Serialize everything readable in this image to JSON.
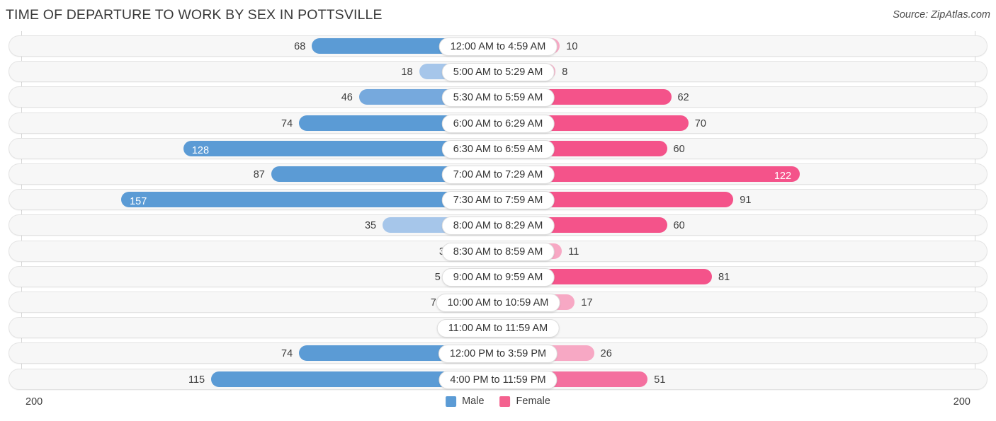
{
  "header": {
    "title": "TIME OF DEPARTURE TO WORK BY SEX IN POTTSVILLE",
    "source": "Source: ZipAtlas.com"
  },
  "axis": {
    "left_label": "200",
    "right_label": "200"
  },
  "legend": {
    "items": [
      {
        "label": "Male",
        "color": "#5b9bd5"
      },
      {
        "label": "Female",
        "color": "#f4628f"
      }
    ]
  },
  "colors": {
    "male_dark": "#5b9bd5",
    "male_mid": "#76a9dd",
    "male_light": "#a6c6ea",
    "female_dark": "#f4538a",
    "female_mid": "#f4709f",
    "female_light": "#f7a8c4",
    "track_fill": "#f7f7f7",
    "track_border": "#e3e3e3",
    "gridline": "#d7d7d7",
    "text": "#3c3c3c"
  },
  "chart_data": {
    "type": "bar",
    "title": "TIME OF DEPARTURE TO WORK BY SEX IN POTTSVILLE",
    "subtitle": "",
    "orientation": "horizontal-diverging",
    "xlabel": "",
    "ylabel": "",
    "axis_max": 200,
    "grid": true,
    "legend_position": "bottom-center",
    "categories": [
      "12:00 AM to 4:59 AM",
      "5:00 AM to 5:29 AM",
      "5:30 AM to 5:59 AM",
      "6:00 AM to 6:29 AM",
      "6:30 AM to 6:59 AM",
      "7:00 AM to 7:29 AM",
      "7:30 AM to 7:59 AM",
      "8:00 AM to 8:29 AM",
      "8:30 AM to 8:59 AM",
      "9:00 AM to 9:59 AM",
      "10:00 AM to 10:59 AM",
      "11:00 AM to 11:59 AM",
      "12:00 PM to 3:59 PM",
      "4:00 PM to 11:59 PM"
    ],
    "series": [
      {
        "name": "Male",
        "values": [
          68,
          18,
          46,
          74,
          128,
          87,
          157,
          35,
          3,
          5,
          7,
          0,
          74,
          115
        ]
      },
      {
        "name": "Female",
        "values": [
          10,
          8,
          62,
          70,
          60,
          122,
          91,
          60,
          11,
          81,
          17,
          0,
          26,
          51
        ]
      }
    ]
  },
  "rows": [
    {
      "label": "12:00 AM to 4:59 AM",
      "male": "68",
      "female": "10"
    },
    {
      "label": "5:00 AM to 5:29 AM",
      "male": "18",
      "female": "8"
    },
    {
      "label": "5:30 AM to 5:59 AM",
      "male": "46",
      "female": "62"
    },
    {
      "label": "6:00 AM to 6:29 AM",
      "male": "74",
      "female": "70"
    },
    {
      "label": "6:30 AM to 6:59 AM",
      "male": "128",
      "female": "60"
    },
    {
      "label": "7:00 AM to 7:29 AM",
      "male": "87",
      "female": "122"
    },
    {
      "label": "7:30 AM to 7:59 AM",
      "male": "157",
      "female": "91"
    },
    {
      "label": "8:00 AM to 8:29 AM",
      "male": "35",
      "female": "60"
    },
    {
      "label": "8:30 AM to 8:59 AM",
      "male": "3",
      "female": "11"
    },
    {
      "label": "9:00 AM to 9:59 AM",
      "male": "5",
      "female": "81"
    },
    {
      "label": "10:00 AM to 10:59 AM",
      "male": "7",
      "female": "17"
    },
    {
      "label": "11:00 AM to 11:59 AM",
      "male": "0",
      "female": "0"
    },
    {
      "label": "12:00 PM to 3:59 PM",
      "male": "74",
      "female": "26"
    },
    {
      "label": "4:00 PM to 11:59 PM",
      "male": "115",
      "female": "51"
    }
  ]
}
